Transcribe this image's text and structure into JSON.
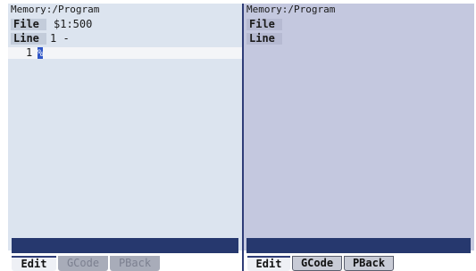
{
  "left": {
    "path": "Memory:/Program",
    "file_label": "File",
    "file_value": "$1:500",
    "line_label": "Line",
    "line_value": "1 -",
    "line_number": "1",
    "cursor_char": "%"
  },
  "right": {
    "path": "Memory:/Program",
    "file_label": "File",
    "line_label": "Line"
  },
  "tabs_left": [
    "Edit",
    "GCode",
    "PBack"
  ],
  "tabs_right": [
    "Edit",
    "GCode",
    "PBack"
  ],
  "colors": {
    "left_bg": "#dce4ef",
    "right_bg": "#c4c8df",
    "accent": "#26386e",
    "cursor": "#2f56c7"
  }
}
